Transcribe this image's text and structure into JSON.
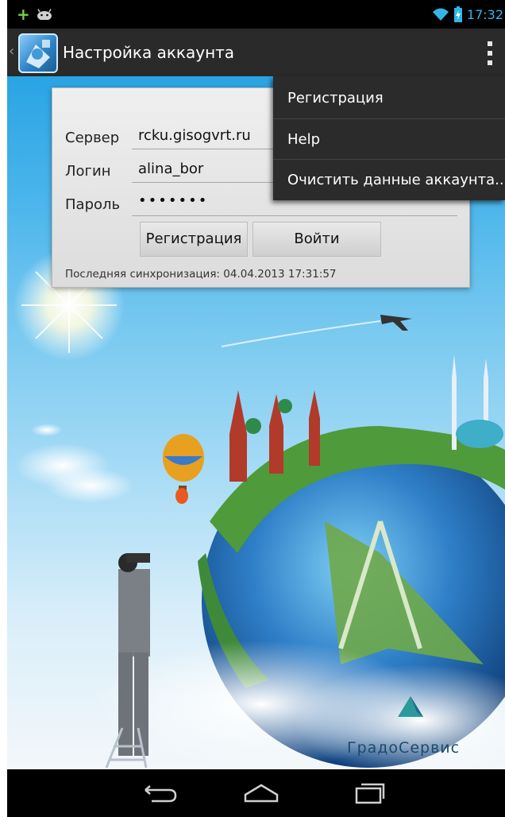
{
  "status_bar": {
    "time": "17:32"
  },
  "action_bar": {
    "title": "Настройка аккаунта"
  },
  "form": {
    "server_label": "Сервер",
    "server_value": "rcku.gisogvrt.ru",
    "login_label": "Логин",
    "login_value": "alina_bor",
    "password_label": "Пароль",
    "password_value": "•••••••",
    "register_button": "Регистрация",
    "login_button": "Войти",
    "last_sync_label": "Последняя синхронизация:",
    "last_sync_value": "04.04.2013 17:31:57"
  },
  "menu": {
    "items": [
      {
        "label": "Регистрация"
      },
      {
        "label": "Help"
      },
      {
        "label": "Очистить данные аккаунта..."
      }
    ]
  },
  "brand": {
    "name": "ГрадоСервис"
  },
  "icons": {
    "status": [
      "plus-icon",
      "android-icon",
      "wifi-icon",
      "battery-icon"
    ],
    "nav": [
      "back-icon",
      "home-icon",
      "recent-apps-icon"
    ]
  },
  "colors": {
    "status_time": "#33b5e5",
    "action_bar": "#2a2a2a",
    "menu": "#2b2b2b"
  }
}
